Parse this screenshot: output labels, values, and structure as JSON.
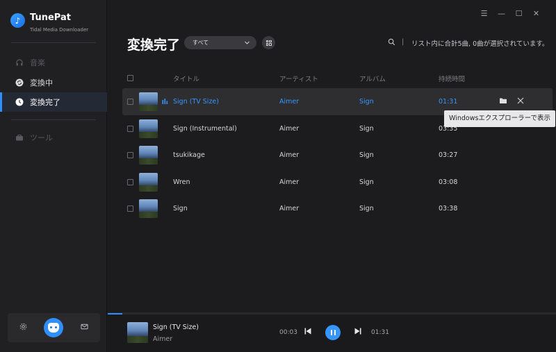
{
  "app": {
    "name": "TunePat",
    "subtitle": "Tidal Media Downloader",
    "logo_glyph": "♪"
  },
  "sidebar": {
    "items": [
      {
        "label": "音楽",
        "icon": "headphones-icon",
        "state": "disabled"
      },
      {
        "label": "変換中",
        "icon": "converting-icon",
        "state": "normal"
      },
      {
        "label": "変換完了",
        "icon": "clock-icon",
        "state": "active"
      },
      {
        "label": "ツール",
        "icon": "toolbox-icon",
        "state": "disabled"
      }
    ]
  },
  "window": {
    "menu_glyph": "☰",
    "minimize_glyph": "—",
    "maximize_glyph": "☐",
    "close_glyph": "✕"
  },
  "header": {
    "title": "変換完了",
    "filter_value": "すべて",
    "status": "リスト内に合計5曲, 0曲が選択されています。"
  },
  "table": {
    "columns": [
      "タイトル",
      "アーティスト",
      "アルバム",
      "持続時間"
    ],
    "rows": [
      {
        "title": "Sign (TV Size)",
        "artist": "Aimer",
        "album": "Sign",
        "duration": "01:31"
      },
      {
        "title": "Sign (Instrumental)",
        "artist": "Aimer",
        "album": "Sign",
        "duration": "03:35"
      },
      {
        "title": "tsukikage",
        "artist": "Aimer",
        "album": "Sign",
        "duration": "03:27"
      },
      {
        "title": "Wren",
        "artist": "Aimer",
        "album": "Sign",
        "duration": "03:08"
      },
      {
        "title": "Sign",
        "artist": "Aimer",
        "album": "Sign",
        "duration": "03:38"
      }
    ],
    "hover_row_index": 0
  },
  "tooltip": {
    "text": "Windowsエクスプローラーで表示"
  },
  "player": {
    "title": "Sign (TV Size)",
    "artist": "Aimer",
    "current_time": "00:03",
    "total_time": "01:31",
    "progress": 0.033
  },
  "colors": {
    "accent": "#3596ff",
    "background": "#1c1c1e",
    "sidebar": "#202022"
  }
}
